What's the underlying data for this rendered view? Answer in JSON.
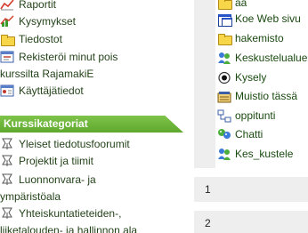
{
  "sidebar": {
    "items": [
      {
        "label": "Raportit",
        "icon": "report-chart-icon"
      },
      {
        "label": "Kysymykset",
        "icon": "questions-chart-icon"
      },
      {
        "label": "Tiedostot",
        "icon": "folder-icon"
      },
      {
        "label": "Rekisteröi minut pois kurssilta RajamakiE",
        "icon": "unenrol-icon"
      },
      {
        "label": "Käyttäjätiedot",
        "icon": "user-profile-icon"
      }
    ],
    "categories_header": "Kurssikategoriat",
    "categories": [
      {
        "label": "Yleiset tiedotusfoorumit",
        "icon": "course-category-icon"
      },
      {
        "label": "Projektit ja tiimit",
        "icon": "course-category-icon"
      },
      {
        "label": "Luonnonvara- ja ympäristöala",
        "icon": "course-category-icon"
      },
      {
        "label": "Yhteiskuntatieteiden-, liiketalouden- ja hallinnon ala",
        "icon": "course-category-icon"
      }
    ]
  },
  "main": {
    "activities": [
      {
        "label": "aa",
        "icon": "folder-icon"
      },
      {
        "label": "Koe Web sivu",
        "icon": "web-page-icon"
      },
      {
        "label": "hakemisto",
        "icon": "folder-icon"
      },
      {
        "label": "Keskustelualue",
        "icon": "forum-icon"
      },
      {
        "label": "Kysely",
        "icon": "choice-icon"
      },
      {
        "label": "Muistio tässä",
        "icon": "journal-icon"
      },
      {
        "label": "oppitunti",
        "icon": "lesson-icon"
      },
      {
        "label": "Chatti",
        "icon": "chat-icon"
      },
      {
        "label": "Kes_kustele",
        "icon": "forum-icon"
      }
    ],
    "sections": [
      {
        "number": "1"
      },
      {
        "number": "2"
      }
    ]
  },
  "colors": {
    "category_header_bg": "#6ab43a",
    "link_text": "#24431a",
    "panel_bg": "#eeeeee"
  }
}
